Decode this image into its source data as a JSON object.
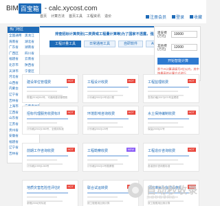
{
  "header": {
    "logo_text": "BIM",
    "logo_box": "百宝箱",
    "domain": "- calc.xycost.com",
    "nav": [
      "首页",
      "计算方法",
      "首页工具",
      "工程资讯",
      "造价"
    ],
    "right_links": [
      "注册会员",
      "登录",
      "收藏"
    ]
  },
  "sidebar": {
    "header": "热门地区",
    "rows": [
      [
        "全国通用",
        "黑龙江"
      ],
      [
        "海南省",
        "湖北省"
      ],
      [
        "广东省",
        "湖南省"
      ],
      [
        "广西区",
        "四川省"
      ],
      [
        "福建省",
        "云南省"
      ],
      [
        "北京市",
        "陕西省"
      ],
      [
        "天津市",
        "宁夏区"
      ],
      [
        "河北省",
        "江苏省"
      ],
      [
        "山西省",
        "甘肃省"
      ],
      [
        "内蒙古",
        "浙江省"
      ],
      [
        "辽宁省",
        "安徽省"
      ],
      [
        "吉林省",
        "河南省"
      ],
      [
        "上海市",
        "宁夏自治区"
      ],
      [
        "江西省",
        "新疆区"
      ],
      [
        "山东省",
        ""
      ],
      [
        "江苏省",
        ""
      ],
      [
        "贵州省",
        ""
      ],
      [
        "安徽省",
        ""
      ],
      [
        "福建省",
        ""
      ],
      [
        "辽宁省",
        ""
      ],
      [
        "吉林省",
        ""
      ]
    ]
  },
  "banner": {
    "title": "排查招标计算类别(二类费或工程量计算等)为了国家不透露，强烈推荐使用最",
    "tabs": [
      "工程计量工具",
      "日常通用工具",
      "自研软件",
      "AI造价问答"
    ],
    "active_tab": 0
  },
  "calc": {
    "label_amount": "建安费",
    "label_unit": "(万元)",
    "amount_value": "10000",
    "label_other": "其他费",
    "label_other_unit": "(万元)",
    "other_value": "12000",
    "button": "开始智能计算",
    "note": "那个AI计算请填写2位以内，其中按最高的计算方式进行"
  },
  "cards": [
    {
      "title": "建设单位管理费",
      "tag": "HOT",
      "foot": "财建[2016]504号，可通用建设管理费"
    },
    {
      "title": "工程设计收费",
      "tag": "HOT",
      "foot": "计价格[2002]10号设计费"
    },
    {
      "title": "工程监理收费",
      "tag": "HOT",
      "foot": "发改价格[2007]670号监理费"
    },
    {
      "title": "招标代理服务收费标准",
      "tag": "HOT",
      "foot": "计价格[2002]1980号，全费用标准"
    },
    {
      "title": "环境影响咨询收费",
      "tag": "HOT",
      "foot": "计价格[2002]125号"
    },
    {
      "title": "水土保持编制收费",
      "tag": "HOT",
      "foot": "保监[2005]22号"
    },
    {
      "title": "前期工作咨询收费",
      "tag": "HOT",
      "foot": "计价格[1999]1283号"
    },
    {
      "title": "工程勘察收费",
      "tag": "NEW",
      "foot": "计价格[2002]10号勘察费"
    },
    {
      "title": "工程造价咨询收费",
      "tag": "HOT",
      "foot": "各省造价咨询费标准"
    },
    {
      "title": "地质灾害危险性评估收费",
      "tag": "HOT",
      "foot": "参照[2006]号标准"
    },
    {
      "title": "联合试运转费",
      "tag": "HOT",
      "foot": "按工程费用比例计算"
    },
    {
      "title": "场地准备及临时设施费",
      "tag": "HOT",
      "foot": "按工程费用比例计算"
    }
  ],
  "watermark": {
    "main": "自动秒收录",
    "sub": "自动秒收录网站"
  },
  "colors": {
    "brand_blue": "#1e6bb8",
    "hot_red": "#e9453b",
    "new_purple": "#8b5cf6"
  }
}
